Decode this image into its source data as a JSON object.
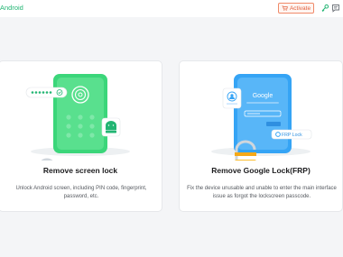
{
  "app": {
    "title": "Android"
  },
  "header": {
    "activate_label": "Activate"
  },
  "colors": {
    "brand_green": "#22b573",
    "accent_orange": "#e0613f",
    "phone_green": "#3bd67a",
    "phone_blue": "#35a4f5"
  },
  "cards": [
    {
      "title": "Remove screen lock",
      "description": "Unlock Android screen, including PIN code, fingerprint, password, etc."
    },
    {
      "title": "Remove Google Lock(FRP)",
      "description": "Fix the device unusable and unable to enter the main interface issue as forgot the lockscreen passcode.",
      "illustration": {
        "google_label": "Google",
        "frp_badge": "FRP Lock"
      }
    }
  ]
}
